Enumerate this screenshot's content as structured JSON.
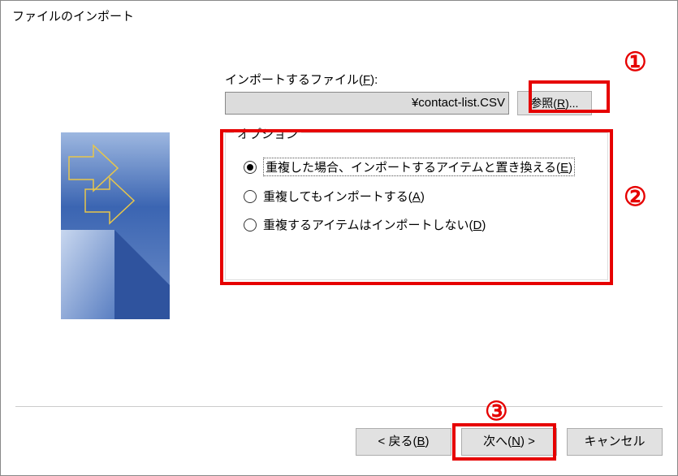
{
  "title": "ファイルのインポート",
  "file": {
    "label_pre": "インポートするファイル(",
    "label_u": "F",
    "label_post": "):",
    "value": "¥contact-list.CSV",
    "browse_pre": "参照(",
    "browse_u": "R",
    "browse_post": ")..."
  },
  "options": {
    "legend": "オプション",
    "opt1_pre": "重複した場合、インポートするアイテムと置き換える(",
    "opt1_u": "E",
    "opt1_post": ")",
    "opt2_pre": "重複してもインポートする(",
    "opt2_u": "A",
    "opt2_post": ")",
    "opt3_pre": "重複するアイテムはインポートしない(",
    "opt3_u": "D",
    "opt3_post": ")"
  },
  "buttons": {
    "back_pre": "< 戻る(",
    "back_u": "B",
    "back_post": ")",
    "next_pre": "次へ(",
    "next_u": "N",
    "next_post": ") >",
    "cancel": "キャンセル"
  },
  "annotations": {
    "n1": "①",
    "n2": "②",
    "n3": "③"
  }
}
